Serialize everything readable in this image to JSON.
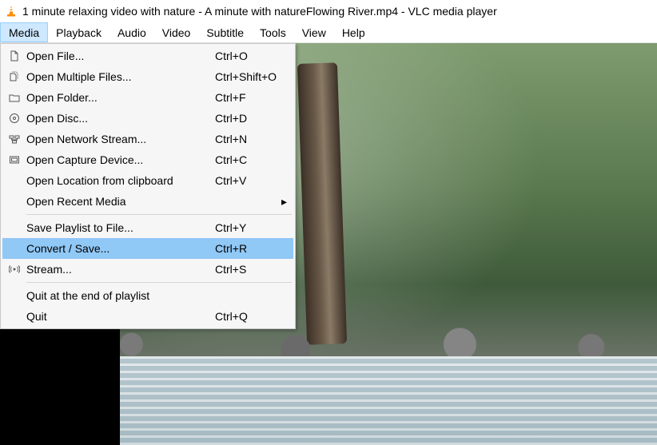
{
  "title": "1 minute relaxing video with nature - A minute with natureFlowing River.mp4 - VLC media player",
  "menubar": [
    "Media",
    "Playback",
    "Audio",
    "Video",
    "Subtitle",
    "Tools",
    "View",
    "Help"
  ],
  "active_menu_index": 0,
  "media_menu": {
    "items": [
      {
        "icon": "file",
        "label": "Open File...",
        "shortcut": "Ctrl+O"
      },
      {
        "icon": "files",
        "label": "Open Multiple Files...",
        "shortcut": "Ctrl+Shift+O"
      },
      {
        "icon": "folder",
        "label": "Open Folder...",
        "shortcut": "Ctrl+F"
      },
      {
        "icon": "disc",
        "label": "Open Disc...",
        "shortcut": "Ctrl+D"
      },
      {
        "icon": "network",
        "label": "Open Network Stream...",
        "shortcut": "Ctrl+N"
      },
      {
        "icon": "capture",
        "label": "Open Capture Device...",
        "shortcut": "Ctrl+C"
      },
      {
        "icon": "",
        "label": "Open Location from clipboard",
        "shortcut": "Ctrl+V"
      },
      {
        "icon": "",
        "label": "Open Recent Media",
        "shortcut": "",
        "submenu": true
      }
    ],
    "items2": [
      {
        "icon": "",
        "label": "Save Playlist to File...",
        "shortcut": "Ctrl+Y"
      },
      {
        "icon": "",
        "label": "Convert / Save...",
        "shortcut": "Ctrl+R",
        "highlight": true
      },
      {
        "icon": "stream",
        "label": "Stream...",
        "shortcut": "Ctrl+S"
      }
    ],
    "items3": [
      {
        "icon": "",
        "label": "Quit at the end of playlist",
        "shortcut": ""
      },
      {
        "icon": "",
        "label": "Quit",
        "shortcut": "Ctrl+Q"
      }
    ]
  }
}
